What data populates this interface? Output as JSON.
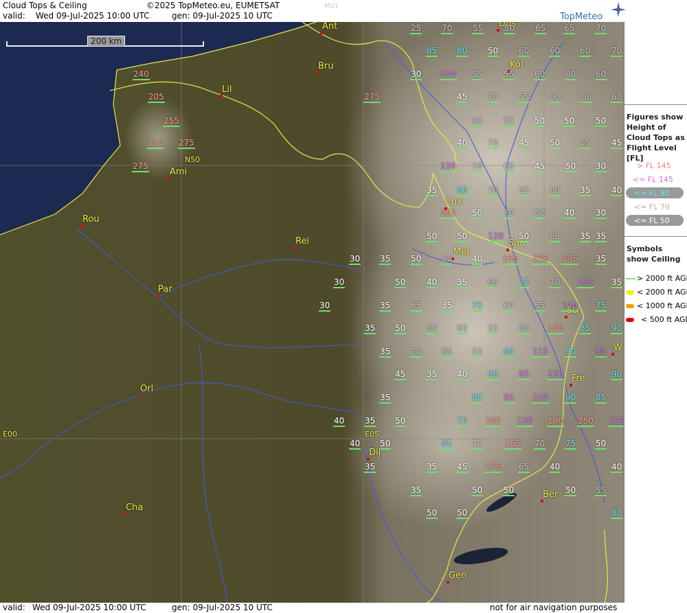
{
  "header": {
    "title": "Cloud Tops & Ceiling",
    "copyright": "©2025 TopMeteo.eu, EUMETSAT",
    "valid_label": "valid:",
    "valid_value": "Wed  09-Jul-2025  10:00 UTC",
    "gen": "gen: 09-Jul-2025 10 UTC",
    "run_code": "9521",
    "brand": "TopMeteo"
  },
  "footer": {
    "valid_label": "valid:",
    "valid_value": "Wed  09-Jul-2025  10:00 UTC",
    "gen": "gen: 09-Jul-2025 10 UTC",
    "disclaimer": "not for air navigation purposes"
  },
  "scale": {
    "label": "200 km"
  },
  "grid_labels": {
    "lat": "N50",
    "lon0": "E00",
    "lon5": "E05"
  },
  "cities": [
    {
      "name": "Ant"
    },
    {
      "name": "Bru"
    },
    {
      "name": "Lil"
    },
    {
      "name": "Ami"
    },
    {
      "name": "Rou"
    },
    {
      "name": "Rei"
    },
    {
      "name": "Par"
    },
    {
      "name": "Orl"
    },
    {
      "name": "Cha"
    },
    {
      "name": "Dij"
    },
    {
      "name": "Met"
    },
    {
      "name": "Lux"
    },
    {
      "name": "Saa"
    },
    {
      "name": "Köl"
    },
    {
      "name": "Düs"
    },
    {
      "name": "Str"
    },
    {
      "name": "Fre"
    },
    {
      "name": "Ber"
    },
    {
      "name": "Gen"
    },
    {
      "name": "W"
    }
  ],
  "cloud_tops": [
    {
      "fl": "25",
      "k": "c3"
    },
    {
      "fl": "70",
      "k": "c3"
    },
    {
      "fl": "55",
      "k": "c3"
    },
    {
      "fl": "50",
      "k": "c3"
    },
    {
      "fl": "65",
      "k": "c3"
    },
    {
      "fl": "65",
      "k": "c3"
    },
    {
      "fl": "70",
      "k": "c3"
    },
    {
      "fl": "85",
      "k": "c2"
    },
    {
      "fl": "80",
      "k": "c2"
    },
    {
      "fl": "50",
      "k": "c4"
    },
    {
      "fl": "60",
      "k": "c3"
    },
    {
      "fl": "60",
      "k": "c3"
    },
    {
      "fl": "60",
      "k": "c3"
    },
    {
      "fl": "70",
      "k": "c3"
    },
    {
      "fl": "30",
      "k": "c4"
    },
    {
      "fl": "140",
      "k": "c1"
    },
    {
      "fl": "55",
      "k": "c3"
    },
    {
      "fl": "55",
      "k": "c3"
    },
    {
      "fl": "60",
      "k": "c3"
    },
    {
      "fl": "60",
      "k": "c3"
    },
    {
      "fl": "60",
      "k": "c3"
    },
    {
      "fl": "240",
      "k": "c0"
    },
    {
      "fl": "205",
      "k": "c0"
    },
    {
      "fl": "255",
      "k": "c0"
    },
    {
      "fl": "225",
      "k": "c0"
    },
    {
      "fl": "275",
      "k": "c0"
    },
    {
      "fl": "275",
      "k": "c0"
    },
    {
      "fl": "275",
      "k": "c0"
    },
    {
      "fl": "45",
      "k": "c4"
    },
    {
      "fl": "70",
      "k": "c3"
    },
    {
      "fl": "55",
      "k": "c3"
    },
    {
      "fl": "60",
      "k": "c3"
    },
    {
      "fl": "60",
      "k": "c3"
    },
    {
      "fl": "60",
      "k": "c3"
    },
    {
      "fl": "60",
      "k": "c3"
    },
    {
      "fl": "55",
      "k": "c3"
    },
    {
      "fl": "50",
      "k": "c4"
    },
    {
      "fl": "50",
      "k": "c4"
    },
    {
      "fl": "50",
      "k": "c4"
    },
    {
      "fl": "40",
      "k": "c4"
    },
    {
      "fl": "70",
      "k": "c3"
    },
    {
      "fl": "45",
      "k": "c4"
    },
    {
      "fl": "50",
      "k": "c4"
    },
    {
      "fl": "55",
      "k": "c3"
    },
    {
      "fl": "45",
      "k": "c4"
    },
    {
      "fl": "120",
      "k": "c1"
    },
    {
      "fl": "70",
      "k": "c3"
    },
    {
      "fl": "65",
      "k": "c3"
    },
    {
      "fl": "45",
      "k": "c4"
    },
    {
      "fl": "50",
      "k": "c4"
    },
    {
      "fl": "30",
      "k": "c4"
    },
    {
      "fl": "35",
      "k": "c4"
    },
    {
      "fl": "80",
      "k": "c2"
    },
    {
      "fl": "70",
      "k": "c3"
    },
    {
      "fl": "65",
      "k": "c3"
    },
    {
      "fl": "60",
      "k": "c3"
    },
    {
      "fl": "35",
      "k": "c4"
    },
    {
      "fl": "40",
      "k": "c4"
    },
    {
      "fl": "355",
      "k": "c0"
    },
    {
      "fl": "50",
      "k": "c4"
    },
    {
      "fl": "70",
      "k": "c3"
    },
    {
      "fl": "60",
      "k": "c3"
    },
    {
      "fl": "40",
      "k": "c4"
    },
    {
      "fl": "30",
      "k": "c4"
    },
    {
      "fl": "50",
      "k": "c4"
    },
    {
      "fl": "50",
      "k": "c4"
    },
    {
      "fl": "120",
      "k": "c1"
    },
    {
      "fl": "50",
      "k": "c4"
    },
    {
      "fl": "65",
      "k": "c3"
    },
    {
      "fl": "35",
      "k": "c4"
    },
    {
      "fl": "35",
      "k": "c4"
    },
    {
      "fl": "30",
      "k": "c4"
    },
    {
      "fl": "35",
      "k": "c4"
    },
    {
      "fl": "50",
      "k": "c4"
    },
    {
      "fl": "60",
      "k": "c3"
    },
    {
      "fl": "40",
      "k": "c4"
    },
    {
      "fl": "155",
      "k": "c0"
    },
    {
      "fl": "155",
      "k": "c0"
    },
    {
      "fl": "195",
      "k": "c0"
    },
    {
      "fl": "35",
      "k": "c4"
    },
    {
      "fl": "30",
      "k": "c4"
    },
    {
      "fl": "50",
      "k": "c4"
    },
    {
      "fl": "40",
      "k": "c4"
    },
    {
      "fl": "35",
      "k": "c4"
    },
    {
      "fl": "65",
      "k": "c3"
    },
    {
      "fl": "75",
      "k": "c2"
    },
    {
      "fl": "70",
      "k": "c3"
    },
    {
      "fl": "125",
      "k": "c1"
    },
    {
      "fl": "35",
      "k": "c4"
    },
    {
      "fl": "30",
      "k": "c4"
    },
    {
      "fl": "35",
      "k": "c4"
    },
    {
      "fl": "65",
      "k": "c3"
    },
    {
      "fl": "35",
      "k": "c4"
    },
    {
      "fl": "75",
      "k": "c2"
    },
    {
      "fl": "60",
      "k": "c3"
    },
    {
      "fl": "55",
      "k": "c3"
    },
    {
      "fl": "110",
      "k": "c1"
    },
    {
      "fl": "75",
      "k": "c2"
    },
    {
      "fl": "35",
      "k": "c4"
    },
    {
      "fl": "50",
      "k": "c4"
    },
    {
      "fl": "60",
      "k": "c3"
    },
    {
      "fl": "60",
      "k": "c3"
    },
    {
      "fl": "55",
      "k": "c3"
    },
    {
      "fl": "60",
      "k": "c3"
    },
    {
      "fl": "155",
      "k": "c0"
    },
    {
      "fl": "85",
      "k": "c2"
    },
    {
      "fl": "90",
      "k": "c2"
    },
    {
      "fl": "35",
      "k": "c4"
    },
    {
      "fl": "70",
      "k": "c3"
    },
    {
      "fl": "65",
      "k": "c3"
    },
    {
      "fl": "55",
      "k": "c3"
    },
    {
      "fl": "80",
      "k": "c2"
    },
    {
      "fl": "115",
      "k": "c1"
    },
    {
      "fl": "90",
      "k": "c2"
    },
    {
      "fl": "95",
      "k": "c1"
    },
    {
      "fl": "45",
      "k": "c4"
    },
    {
      "fl": "35",
      "k": "c4"
    },
    {
      "fl": "40",
      "k": "c4"
    },
    {
      "fl": "90",
      "k": "c2"
    },
    {
      "fl": "95",
      "k": "c1"
    },
    {
      "fl": "120",
      "k": "c1"
    },
    {
      "fl": "90",
      "k": "c2"
    },
    {
      "fl": "35",
      "k": "c4"
    },
    {
      "fl": "85",
      "k": "c2"
    },
    {
      "fl": "95",
      "k": "c1"
    },
    {
      "fl": "110",
      "k": "c1"
    },
    {
      "fl": "90",
      "k": "c2"
    },
    {
      "fl": "85",
      "k": "c2"
    },
    {
      "fl": "40",
      "k": "c4"
    },
    {
      "fl": "35",
      "k": "c4"
    },
    {
      "fl": "50",
      "k": "c4"
    },
    {
      "fl": "75",
      "k": "c2"
    },
    {
      "fl": "185",
      "k": "c0"
    },
    {
      "fl": "120",
      "k": "c1"
    },
    {
      "fl": "190",
      "k": "c0"
    },
    {
      "fl": "250",
      "k": "c0"
    },
    {
      "fl": "125",
      "k": "c1"
    },
    {
      "fl": "40",
      "k": "c4"
    },
    {
      "fl": "50",
      "k": "c4"
    },
    {
      "fl": "85",
      "k": "c2"
    },
    {
      "fl": "70",
      "k": "c3"
    },
    {
      "fl": "155",
      "k": "c0"
    },
    {
      "fl": "70",
      "k": "c3"
    },
    {
      "fl": "75",
      "k": "c2"
    },
    {
      "fl": "50",
      "k": "c4"
    },
    {
      "fl": "35",
      "k": "c4"
    },
    {
      "fl": "35",
      "k": "c4"
    },
    {
      "fl": "45",
      "k": "c4"
    },
    {
      "fl": "175",
      "k": "c0"
    },
    {
      "fl": "65",
      "k": "c3"
    },
    {
      "fl": "40",
      "k": "c4"
    },
    {
      "fl": "40",
      "k": "c4"
    },
    {
      "fl": "35",
      "k": "c4"
    },
    {
      "fl": "50",
      "k": "c4"
    },
    {
      "fl": "50",
      "k": "c4"
    },
    {
      "fl": "50",
      "k": "c4"
    },
    {
      "fl": "55",
      "k": "c3"
    },
    {
      "fl": "50",
      "k": "c4"
    },
    {
      "fl": "50",
      "k": "c4"
    },
    {
      "fl": "80",
      "k": "c2"
    }
  ],
  "legend": {
    "tops_heading": "Figures show Height of Cloud Tops as Flight Level  [FL]",
    "tops_items": [
      {
        "label": "> FL 145",
        "color": "#f08080"
      },
      {
        "label": "<= FL 145",
        "color": "#d070e0"
      },
      {
        "label": "<= FL 90",
        "color": "#60e8f0"
      },
      {
        "label": "<= FL 70",
        "color": "#b0b0b0"
      },
      {
        "label": "<= FL 50",
        "color": "#ffffff"
      }
    ],
    "ceiling_heading": "Symbols show Ceiling",
    "ceiling_items": [
      {
        "label": "> 2000 ft AGL",
        "color": "#80e080"
      },
      {
        "label": "< 2000 ft AGL",
        "color": "#f0f020"
      },
      {
        "label": "< 1000 ft AGL",
        "color": "#f0a000"
      },
      {
        "label": "< 500 ft AGL",
        "color": "#e00000"
      }
    ]
  },
  "colors": {
    "c0": "#ff9a8a",
    "c1": "#d07ae6",
    "c2": "#6ee6ee",
    "c3": "#c9c9c9",
    "c4": "#ffffff"
  }
}
